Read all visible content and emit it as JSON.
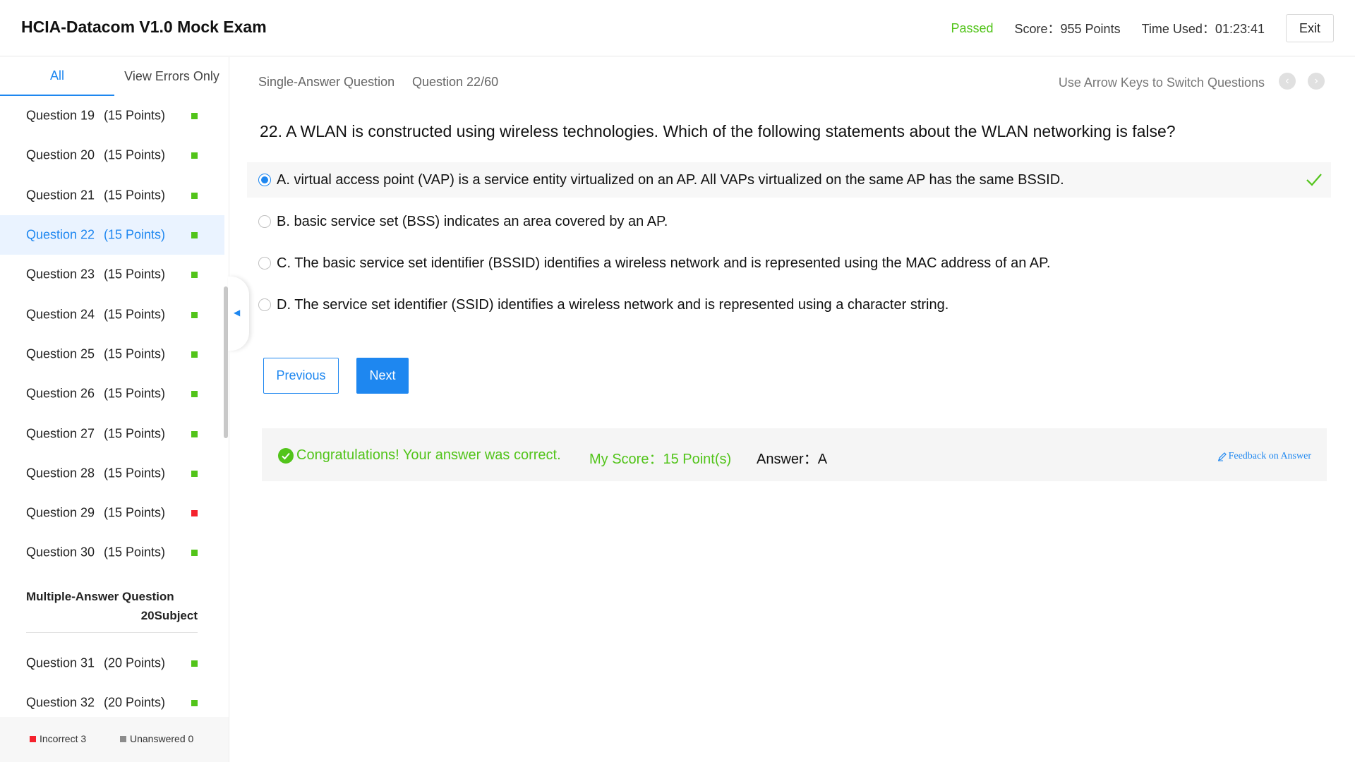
{
  "header": {
    "title": "HCIA-Datacom V1.0 Mock Exam",
    "status": "Passed",
    "score": "Score：955 Points",
    "time_used": "Time Used：01:23:41",
    "exit_label": "Exit"
  },
  "sidebar": {
    "tabs": {
      "all": "All",
      "errors": "View Errors Only"
    },
    "questions_a": [
      {
        "label": "Question 19",
        "points": "(15 Points)",
        "status": "correct"
      },
      {
        "label": "Question 20",
        "points": "(15 Points)",
        "status": "correct"
      },
      {
        "label": "Question 21",
        "points": "(15 Points)",
        "status": "correct"
      },
      {
        "label": "Question 22",
        "points": "(15 Points)",
        "status": "correct",
        "active": true
      },
      {
        "label": "Question 23",
        "points": "(15 Points)",
        "status": "correct"
      },
      {
        "label": "Question 24",
        "points": "(15 Points)",
        "status": "correct"
      },
      {
        "label": "Question 25",
        "points": "(15 Points)",
        "status": "correct"
      },
      {
        "label": "Question 26",
        "points": "(15 Points)",
        "status": "correct"
      },
      {
        "label": "Question 27",
        "points": "(15 Points)",
        "status": "correct"
      },
      {
        "label": "Question 28",
        "points": "(15 Points)",
        "status": "correct"
      },
      {
        "label": "Question 29",
        "points": "(15 Points)",
        "status": "incorrect"
      },
      {
        "label": "Question 30",
        "points": "(15 Points)",
        "status": "correct"
      }
    ],
    "section": {
      "title": "Multiple-Answer Question",
      "count": "20Subject"
    },
    "questions_b": [
      {
        "label": "Question 31",
        "points": "(20 Points)",
        "status": "correct"
      },
      {
        "label": "Question 32",
        "points": "(20 Points)",
        "status": "correct"
      }
    ],
    "legend": {
      "incorrect": "Incorrect 3",
      "unanswered": "Unanswered 0"
    }
  },
  "main": {
    "question_type": "Single-Answer Question",
    "question_number": "Question 22/60",
    "arrow_hint": "Use Arrow Keys to Switch Questions",
    "question_text": "22. A WLAN is constructed using wireless technologies. Which of the following statements about the WLAN networking is false?",
    "options": [
      {
        "text": "A. virtual access point (VAP) is a service entity virtualized on an AP. All VAPs virtualized on the same AP has the same BSSID.",
        "selected": true,
        "correct": true
      },
      {
        "text": "B. basic service set (BSS) indicates an area covered by an AP."
      },
      {
        "text": "C. The basic service set identifier (BSSID) identifies a wireless network and is represented using the MAC address of an AP."
      },
      {
        "text": "D. The service set identifier (SSID) identifies a wireless network and is represented using a character string."
      }
    ],
    "prev_label": "Previous",
    "next_label": "Next",
    "result": {
      "message": "Congratulations! Your answer was correct.",
      "my_score": "My Score：15 Point(s)",
      "answer": "Answer：A",
      "feedback": "Feedback on Answer"
    }
  },
  "colors": {
    "accent": "#1e87f0",
    "correct": "#52c41a",
    "incorrect": "#f5222d",
    "unanswered": "#8c8c8c"
  }
}
